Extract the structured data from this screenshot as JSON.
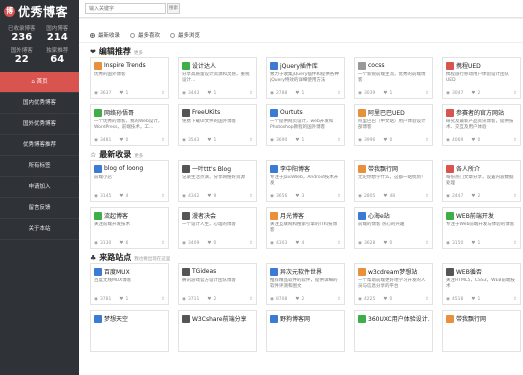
{
  "logo": {
    "mark": "博",
    "text": "优秀博客"
  },
  "stats": [
    {
      "label": "已收录博客",
      "value": "236"
    },
    {
      "label": "国内博客",
      "value": "214"
    },
    {
      "label": "国外博客",
      "value": "22"
    },
    {
      "label": "独家推荐",
      "value": "64"
    }
  ],
  "nav": [
    {
      "label": "⌂ 首页"
    },
    {
      "label": "国内优秀博客"
    },
    {
      "label": "国外优秀博客"
    },
    {
      "label": "优秀博客推荐"
    },
    {
      "label": "所有标签"
    },
    {
      "label": "申请加入"
    },
    {
      "label": "留言反馈"
    },
    {
      "label": "关于本站"
    }
  ],
  "search": {
    "placeholder": "输入关键字",
    "button": "搜索"
  },
  "tabs": [
    {
      "label": "最新收录"
    },
    {
      "label": "最多喜欢"
    },
    {
      "label": "最多浏览"
    }
  ],
  "sections": [
    {
      "icon": "❤",
      "title": "编辑推荐",
      "more": "更多",
      "cards": [
        {
          "name": "Inspire Trends",
          "desc": "优秀的国外博客",
          "views": "3637",
          "likes": "1",
          "color": "#e8903c"
        },
        {
          "name": "设计达人",
          "desc": "分享高质量设计资源和灵感，重视设计…",
          "views": "3443",
          "likes": "1",
          "color": "#3fae49"
        },
        {
          "name": "jQuery插件库",
          "desc": "致力于收集jQuery插件和提供各种jQuery特效的详细使用方法",
          "views": "2788",
          "likes": "1",
          "color": "#3b7bd4"
        },
        {
          "name": "cocss",
          "desc": "一个新锐前端主流，优秀的前端博客",
          "views": "3039",
          "likes": "1",
          "color": "#999999"
        },
        {
          "name": "携程UED",
          "desc": "携程旅行移动用户体验设计团队UED",
          "views": "3047",
          "likes": "2",
          "color": "#d9534f"
        },
        {
          "name": "网络孙悟哥",
          "desc": "一个优秀的博客，我的Web设计，WordPress，前端技术，工…",
          "views": "3481",
          "likes": "0",
          "color": "#3fae49"
        },
        {
          "name": "FreeUKits",
          "desc": "免费下载UI文件的国外博客",
          "views": "3543",
          "likes": "1",
          "color": "#555555"
        },
        {
          "name": "Ourtuts",
          "desc": "一个提供网页设计，web开发和Photoshop教程的国外博客",
          "views": "3690",
          "likes": "1",
          "color": "#3b7bd4"
        },
        {
          "name": "阿里巴巴UED",
          "desc": "阿里巴巴（中文站）用户体验设计部博客",
          "views": "3996",
          "likes": "0",
          "color": "#e8903c"
        },
        {
          "name": "参赛者的官方网站",
          "desc": "研究及最新产品资讯博客，提供技术、交互及用户体验",
          "views": "4069",
          "likes": "0",
          "color": "#d9534f"
        }
      ]
    },
    {
      "icon": "☆",
      "title": "最新收录",
      "more": "更多",
      "cards": [
        {
          "name": "blog of loong",
          "desc": "前端小店",
          "views": "3145",
          "likes": "4",
          "color": "#3b7bd4"
        },
        {
          "name": "一叶ttt's Blog",
          "desc": "记录生活点滴，分享网络好资源",
          "views": "4342",
          "likes": "9",
          "color": "#555555"
        },
        {
          "name": "李中阳博客",
          "desc": "专注于JavaWeb，Android技术开发",
          "views": "3656",
          "likes": "3",
          "color": "#3b7bd4"
        },
        {
          "name": "带我飘行网",
          "desc": "无论你想学什么，这都一站找到！",
          "views": "2805",
          "likes": "48",
          "color": "#e8903c"
        },
        {
          "name": "各人所介",
          "desc": "每份热门文章分享，设置内容数据处理",
          "views": "2447",
          "likes": "2",
          "color": "#d9534f"
        },
        {
          "name": "流起博客",
          "desc": "关注前端开发技术",
          "views": "3130",
          "likes": "6",
          "color": "#3fae49"
        },
        {
          "name": "漫者决会",
          "desc": "一个设计人生，心理的博客",
          "views": "3409",
          "likes": "0",
          "color": "#555555"
        },
        {
          "name": "月光博客",
          "desc": "关注互联网和搜索引擎的IT科技博客",
          "views": "4303",
          "likes": "4",
          "color": "#e8903c"
        },
        {
          "name": "心海e站",
          "desc": "前端的博客 热心的兴趣",
          "views": "3628",
          "likes": "0",
          "color": "#3b7bd4"
        },
        {
          "name": "WEB前端开发",
          "desc": "专注于Web前端开发与体验的博客",
          "views": "3150",
          "likes": "1",
          "color": "#3fae49"
        }
      ]
    },
    {
      "icon": "♣",
      "title": "来路站点",
      "more": "我也要出现在这里",
      "cards": [
        {
          "name": "百度MUX",
          "desc": "百度无线MUX博客",
          "views": "3781",
          "likes": "1",
          "color": "#3b7bd4"
        },
        {
          "name": "TGideas",
          "desc": "腾讯游戏官方设计团队博客",
          "views": "3711",
          "likes": "2",
          "color": "#555555"
        },
        {
          "name": "异次元软件世界",
          "desc": "推荐精品软件的软件，提供详细的软件评测和图文",
          "views": "8708",
          "likes": "2",
          "color": "#3b7bd4"
        },
        {
          "name": "w3cdream梦想站",
          "desc": "一个帮助前端更好地学习开发的人员与信息分享的平台",
          "views": "4225",
          "likes": "0",
          "color": "#e8903c"
        },
        {
          "name": "WEB循否",
          "desc": "关注HTML5，CSS3，WEB前端技术",
          "views": "4518",
          "likes": "1",
          "color": "#555555"
        },
        {
          "name": "梦想天空",
          "desc": "",
          "views": "",
          "likes": "",
          "color": "#3b7bd4"
        },
        {
          "name": "W3Cshare前端分享",
          "desc": "",
          "views": "",
          "likes": "",
          "color": "#555555"
        },
        {
          "name": "野狗博客网",
          "desc": "",
          "views": "",
          "likes": "",
          "color": "#3b7bd4"
        },
        {
          "name": "360UXC用户体验设计…",
          "desc": "",
          "views": "",
          "likes": "",
          "color": "#3fae49"
        },
        {
          "name": "带我飘行网",
          "desc": "",
          "views": "",
          "likes": "",
          "color": "#e8903c"
        }
      ]
    }
  ]
}
